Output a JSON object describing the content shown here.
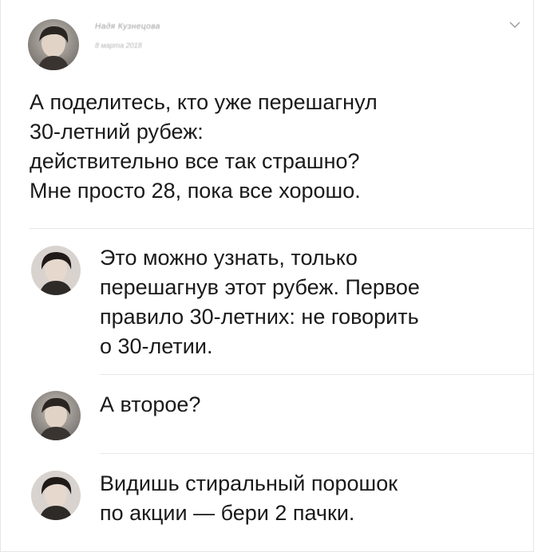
{
  "post": {
    "author": "Надя Кузнецова",
    "timestamp": "8 марта 2018",
    "lines": [
      "А поделитесь, кто уже перешагнул",
      "30-летний рубеж:",
      "действительно все так страшно?",
      "Мне просто 28, пока все хорошо."
    ]
  },
  "comments": [
    {
      "lines": [
        "Это можно узнать, только",
        "перешагнув этот рубеж. Первое",
        "правило 30-летних: не говорить",
        "о 30-летии."
      ]
    },
    {
      "lines": [
        "А второе?"
      ]
    },
    {
      "lines": [
        "Видишь стиральный порошок",
        "по акции — бери 2 пачки."
      ]
    }
  ],
  "icons": {
    "post_avatar": "avatar-photo-icon",
    "comment_avatar": "avatar-photo-icon",
    "menu": "chevron-down-icon"
  },
  "colors": {
    "text": "#1a1a1a",
    "divider": "#e7e7e7",
    "meta": "#9a9a9a"
  }
}
